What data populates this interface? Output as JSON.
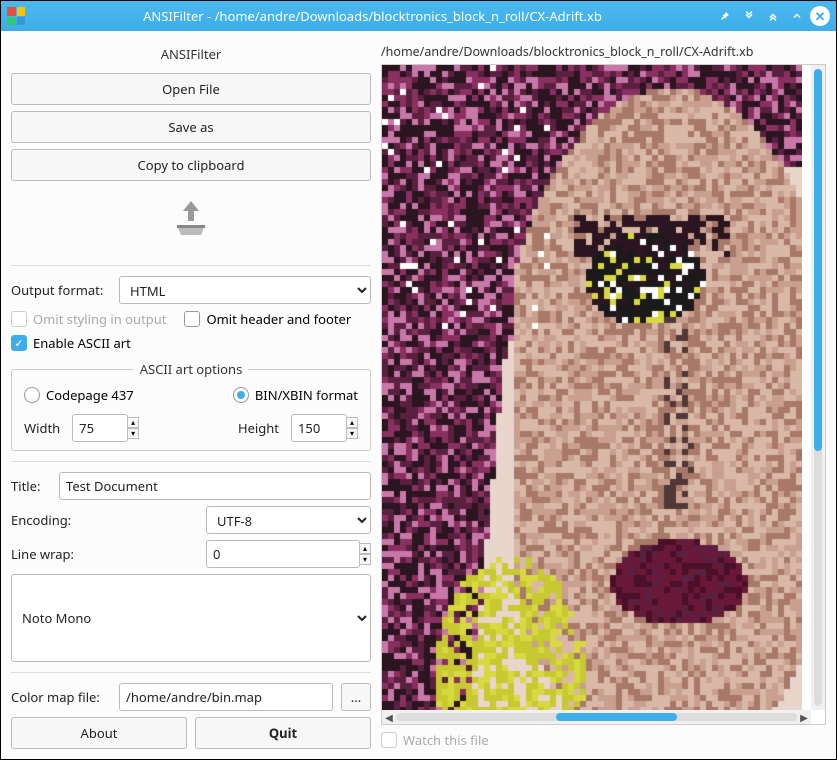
{
  "window": {
    "title": "ANSIFilter - /home/andre/Downloads/blocktronics_block_n_roll/CX-Adrift.xb"
  },
  "panel": {
    "heading": "ANSIFilter",
    "open_file": "Open File",
    "save_as": "Save as",
    "copy_clipboard": "Copy to clipboard",
    "output_format_label": "Output format:",
    "output_format_value": "HTML",
    "omit_styling": "Omit styling in output",
    "omit_header": "Omit header and footer",
    "enable_ascii": "Enable ASCII art",
    "ascii_group_title": "ASCII art options",
    "codepage_label": "Codepage 437",
    "binxbin_label": "BIN/XBIN format",
    "width_label": "Width",
    "width_value": "75",
    "height_label": "Height",
    "height_value": "150",
    "title_label": "Title:",
    "title_value": "Test Document",
    "encoding_label": "Encoding:",
    "encoding_value": "UTF-8",
    "linewrap_label": "Line wrap:",
    "linewrap_value": "0",
    "font_value": "Noto Mono",
    "colormap_label": "Color map file:",
    "colormap_value": "/home/andre/bin.map",
    "browse_label": "...",
    "about": "About",
    "quit": "Quit"
  },
  "preview": {
    "path": "/home/andre/Downloads/blocktronics_block_n_roll/CX-Adrift.xb",
    "watch_label": "Watch this file"
  }
}
